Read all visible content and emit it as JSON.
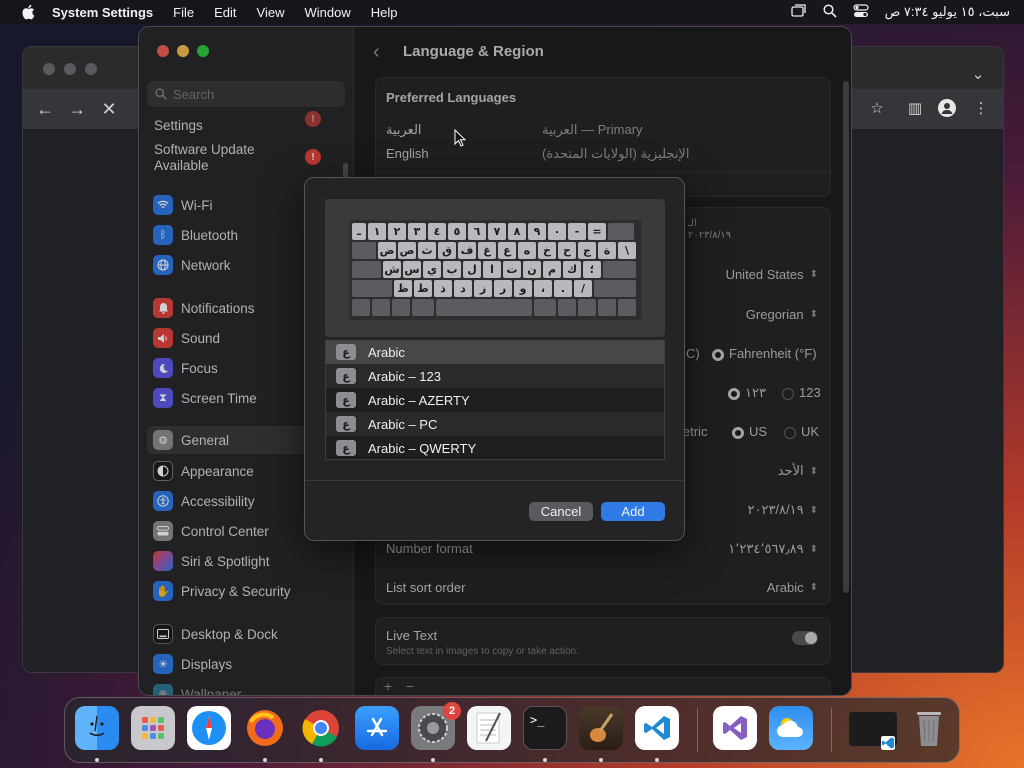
{
  "menubar": {
    "app_name": "System Settings",
    "menus": [
      "File",
      "Edit",
      "View",
      "Window",
      "Help"
    ],
    "clock": "سبت، ١٥ يوليو ٧:٣٤ ص"
  },
  "sidebar": {
    "search_placeholder": "Search",
    "settings_label": "Settings",
    "software_update": "Software Update Available",
    "items": [
      {
        "label": "Wi-Fi",
        "icon": "wifi-icon"
      },
      {
        "label": "Bluetooth",
        "icon": "bluetooth-icon"
      },
      {
        "label": "Network",
        "icon": "globe-icon"
      },
      {
        "label": "Notifications",
        "icon": "bell-icon"
      },
      {
        "label": "Sound",
        "icon": "speaker-icon"
      },
      {
        "label": "Focus",
        "icon": "moon-icon"
      },
      {
        "label": "Screen Time",
        "icon": "hourglass-icon"
      },
      {
        "label": "General",
        "icon": "gear-icon"
      },
      {
        "label": "Appearance",
        "icon": "appearance-icon"
      },
      {
        "label": "Accessibility",
        "icon": "accessibility-icon"
      },
      {
        "label": "Control Center",
        "icon": "control-center-icon"
      },
      {
        "label": "Siri & Spotlight",
        "icon": "siri-icon"
      },
      {
        "label": "Privacy & Security",
        "icon": "hand-icon"
      },
      {
        "label": "Desktop & Dock",
        "icon": "dock-icon"
      },
      {
        "label": "Displays",
        "icon": "sun-icon"
      },
      {
        "label": "Wallpaper",
        "icon": "wallpaper-icon"
      }
    ]
  },
  "main": {
    "title": "Language & Region",
    "preferred_languages": {
      "header": "Preferred Languages",
      "rows": [
        {
          "name": "العربية",
          "detail": "العربية — Primary"
        },
        {
          "name": "English",
          "detail": "الإنجليزية (الولايات المتحدة)"
        }
      ]
    },
    "region": "United States",
    "calendar": "Gregorian",
    "temperature": {
      "celsius_partial": "C)",
      "fahrenheit": "Fahrenheit (°F)"
    },
    "numbers": {
      "arabic": "١٢٣",
      "western": "123"
    },
    "measurement": {
      "partial": "letric",
      "us": "US",
      "uk": "UK"
    },
    "first_day": "الأحد",
    "date_format": "٢٠٢٣/٨/١٩",
    "number_format_label": "Number format",
    "number_format_value": "١٬٢٣٤٬٥٦٧٫٨٩",
    "list_sort_label": "List sort order",
    "list_sort_value": "Arabic",
    "live_text_label": "Live Text",
    "live_text_desc": "Select text in images to copy or take action.",
    "partial_region_text": "الـ",
    "partial_region_sub": "٢٠٢٣/٨/١٩"
  },
  "dialog": {
    "keyboard_rows": [
      [
        "ـ",
        "١",
        "٢",
        "٣",
        "٤",
        "٥",
        "٦",
        "٧",
        "٨",
        "٩",
        "٠",
        "-",
        "="
      ],
      [
        "ض",
        "ص",
        "ث",
        "ق",
        "ف",
        "غ",
        "ع",
        "ه",
        "خ",
        "ح",
        "ج",
        "ة",
        "\\"
      ],
      [
        "ش",
        "س",
        "ي",
        "ب",
        "ل",
        "ا",
        "ت",
        "ن",
        "م",
        "ك",
        "؛"
      ],
      [
        "ظ",
        "ط",
        "ذ",
        "د",
        "ز",
        "ر",
        "و",
        "،",
        ".",
        "/"
      ]
    ],
    "layouts": [
      {
        "label": "Arabic",
        "glyph": "ع"
      },
      {
        "label": "Arabic – 123",
        "glyph": "ع"
      },
      {
        "label": "Arabic – AZERTY",
        "glyph": "ع"
      },
      {
        "label": "Arabic – PC",
        "glyph": "ع"
      },
      {
        "label": "Arabic – QWERTY",
        "glyph": "ع"
      }
    ],
    "cancel_label": "Cancel",
    "add_label": "Add"
  },
  "dock": {
    "apps": [
      {
        "name": "Finder",
        "icon": "finder-icon",
        "color": "#2a8cf0"
      },
      {
        "name": "Launchpad",
        "icon": "launchpad-icon",
        "color": "#c9c9cd"
      },
      {
        "name": "Safari",
        "icon": "safari-icon",
        "color": "#1e8ff5"
      },
      {
        "name": "Firefox",
        "icon": "firefox-icon",
        "color": "#f26b1d"
      },
      {
        "name": "Chrome",
        "icon": "chrome-icon",
        "color": "#ffffff"
      },
      {
        "name": "App Store",
        "icon": "app-store-icon",
        "color": "#1e7ff5"
      },
      {
        "name": "System Settings",
        "icon": "system-settings-icon",
        "color": "#7a7a7e"
      },
      {
        "name": "TextEdit",
        "icon": "textedit-icon",
        "color": "#f2f2f2"
      },
      {
        "name": "Terminal",
        "icon": "terminal-icon",
        "color": "#1b1b1d"
      },
      {
        "name": "Instruments",
        "icon": "guitar-icon",
        "color": "#4a3a2a"
      },
      {
        "name": "VS Code",
        "icon": "vscode-icon",
        "color": "#ffffff"
      },
      {
        "name": "Visual Studio",
        "icon": "visual-studio-icon",
        "color": "#ffffff"
      },
      {
        "name": "Weather",
        "icon": "weather-icon",
        "color": "#2f8ff0"
      }
    ],
    "settings_badge": "2"
  },
  "colors": {
    "accent": "#2f7ae5",
    "badge": "#e0443e"
  }
}
